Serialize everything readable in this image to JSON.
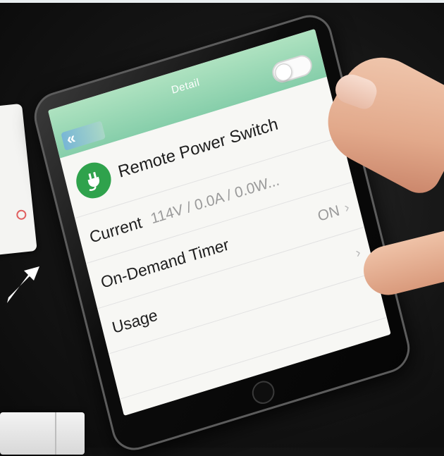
{
  "app": {
    "nav_title": "Detail",
    "back_label": "«",
    "power_toggle_on": false
  },
  "device": {
    "icon": "plug-icon",
    "name": "Remote Power Switch",
    "accent_color": "#2fa24c"
  },
  "rows": {
    "current": {
      "label": "Current",
      "value": "114V / 0.0A / 0.0W..."
    },
    "timer": {
      "label": "On-Demand Timer",
      "value": "ON"
    },
    "usage": {
      "label": "Usage"
    }
  },
  "colors": {
    "navbar": "#9ad8b6",
    "background": "#141414"
  }
}
